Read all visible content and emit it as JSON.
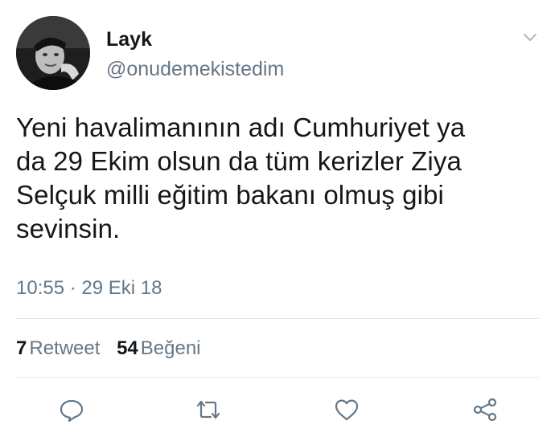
{
  "tweet": {
    "author": {
      "name": "Layk",
      "handle": "@onudemekistedim"
    },
    "lines": [
      "Yeni havalimanının adı Cumhuriyet ya",
      "da 29 Ekim olsun da tüm kerizler Ziya",
      "Selçuk milli eğitim bakanı olmuş gibi",
      "sevinsin."
    ],
    "timestamp": "10:55 · 29 Eki 18",
    "stats": {
      "retweets_count": "7",
      "retweets_label": "Retweet",
      "likes_count": "54",
      "likes_label": "Beğeni"
    }
  },
  "icons": {
    "menu": "chevron-down-icon",
    "reply": "reply-icon",
    "retweet": "retweet-icon",
    "like": "heart-icon",
    "share": "share-icon"
  },
  "colors": {
    "text": "#14171a",
    "secondary": "#657786",
    "divider": "#e1e8ed"
  }
}
